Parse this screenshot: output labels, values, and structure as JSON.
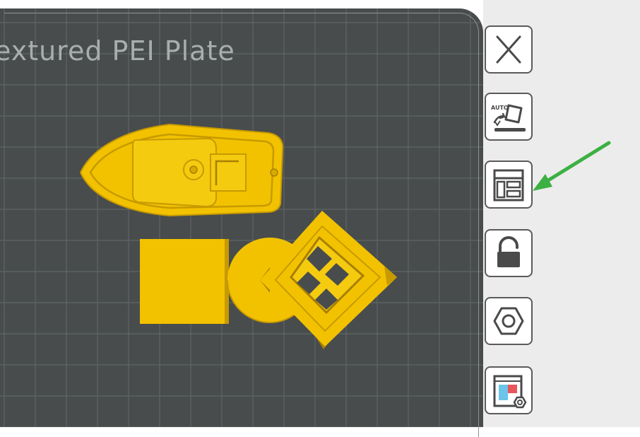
{
  "plate": {
    "title": "extured PEI Plate",
    "background_color": "#484c4d",
    "grid_color": "#5f6566",
    "model_color": "#f2c200",
    "model_shadow_color": "#c79a00"
  },
  "models": [
    {
      "name": "boat",
      "icon": "boat-shape"
    },
    {
      "name": "cube",
      "icon": "square-shape"
    },
    {
      "name": "cylinder",
      "icon": "circle-shape"
    },
    {
      "name": "frame",
      "icon": "rotated-frame-shape"
    }
  ],
  "toolbar": {
    "buttons": [
      {
        "id": "close",
        "icon": "close-icon"
      },
      {
        "id": "auto-orient",
        "icon": "auto-orient-icon",
        "badge": "AUTO"
      },
      {
        "id": "arrange",
        "icon": "arrange-layout-icon"
      },
      {
        "id": "lock",
        "icon": "lock-icon"
      },
      {
        "id": "hex-nut",
        "icon": "hex-nut-icon"
      },
      {
        "id": "plate-settings",
        "icon": "plate-settings-icon"
      }
    ]
  },
  "annotation": {
    "arrow_color": "#3cb043",
    "points_to": "arrange"
  }
}
